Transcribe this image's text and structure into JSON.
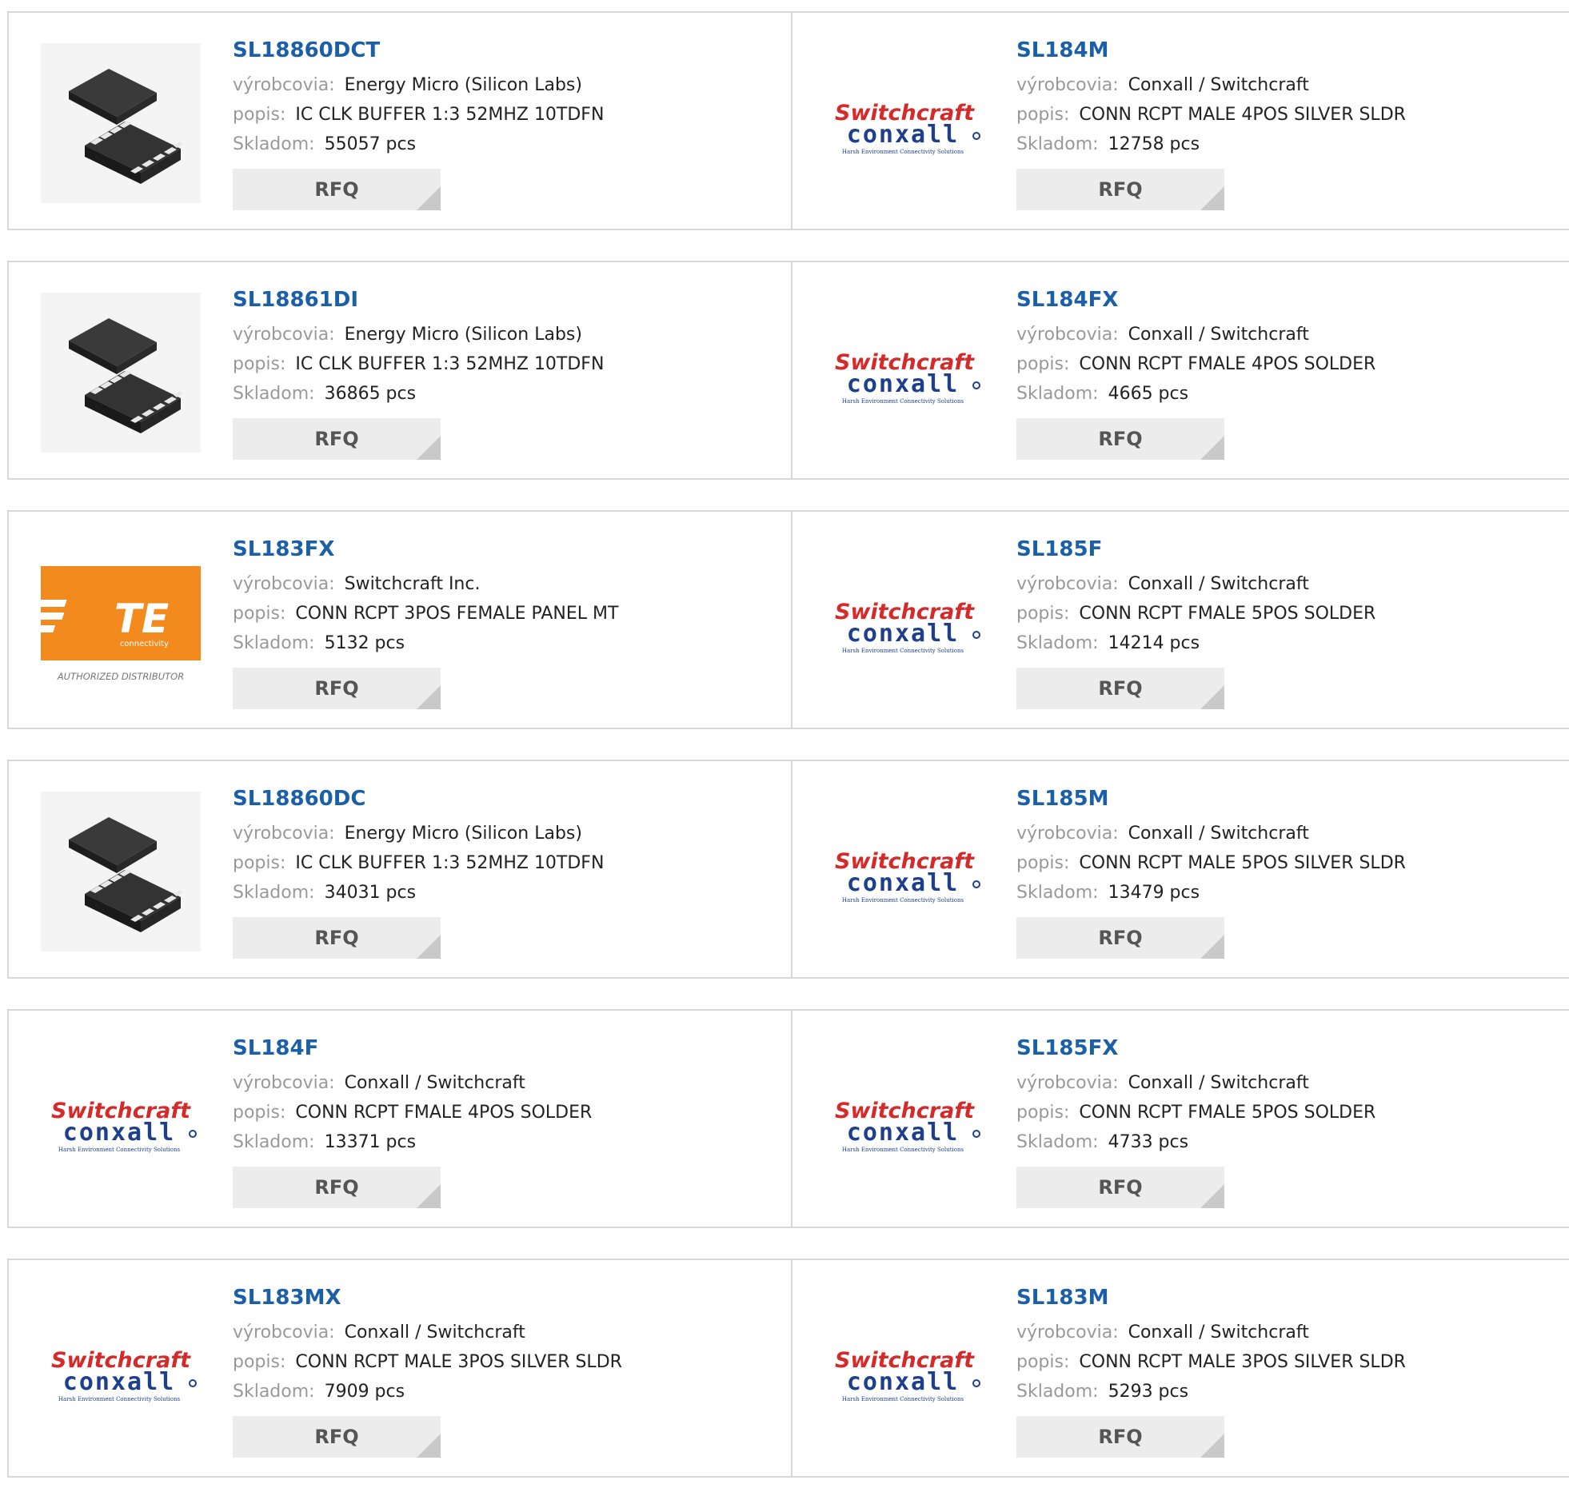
{
  "labels": {
    "manufacturer": "výrobcovia:",
    "description": "popis:",
    "stock": "Skladom:",
    "rfq": "RFQ"
  },
  "logos": {
    "switchcraft": {
      "top": "Switchcraft",
      "bottom": "conxall",
      "tagline": "Harsh Environment Connectivity Solutions",
      "red": "#d42a2a",
      "blue": "#1d3f8c"
    },
    "te": {
      "mark": "TE",
      "sub": "connectivity",
      "caption": "AUTHORIZED DISTRIBUTOR",
      "orange": "#f28a1e"
    }
  },
  "rows": [
    [
      {
        "part": "SL18860DCT",
        "manufacturer": "Energy Micro (Silicon Labs)",
        "description": "IC CLK BUFFER 1:3 52MHZ 10TDFN",
        "stock": "55057 pcs",
        "image": "ic-chip"
      },
      {
        "part": "SL184M",
        "manufacturer": "Conxall / Switchcraft",
        "description": "CONN RCPT MALE 4POS SILVER SLDR",
        "stock": "12758 pcs",
        "image": "switchcraft-logo"
      }
    ],
    [
      {
        "part": "SL18861DI",
        "manufacturer": "Energy Micro (Silicon Labs)",
        "description": "IC CLK BUFFER 1:3 52MHZ 10TDFN",
        "stock": "36865 pcs",
        "image": "ic-chip"
      },
      {
        "part": "SL184FX",
        "manufacturer": "Conxall / Switchcraft",
        "description": "CONN RCPT FMALE 4POS SOLDER",
        "stock": "4665 pcs",
        "image": "switchcraft-logo"
      }
    ],
    [
      {
        "part": "SL183FX",
        "manufacturer": "Switchcraft Inc.",
        "description": "CONN RCPT 3POS FEMALE PANEL MT",
        "stock": "5132 pcs",
        "image": "te-logo"
      },
      {
        "part": "SL185F",
        "manufacturer": "Conxall / Switchcraft",
        "description": "CONN RCPT FMALE 5POS SOLDER",
        "stock": "14214 pcs",
        "image": "switchcraft-logo"
      }
    ],
    [
      {
        "part": "SL18860DC",
        "manufacturer": "Energy Micro (Silicon Labs)",
        "description": "IC CLK BUFFER 1:3 52MHZ 10TDFN",
        "stock": "34031 pcs",
        "image": "ic-chip"
      },
      {
        "part": "SL185M",
        "manufacturer": "Conxall / Switchcraft",
        "description": "CONN RCPT MALE 5POS SILVER SLDR",
        "stock": "13479 pcs",
        "image": "switchcraft-logo"
      }
    ],
    [
      {
        "part": "SL184F",
        "manufacturer": "Conxall / Switchcraft",
        "description": "CONN RCPT FMALE 4POS SOLDER",
        "stock": "13371 pcs",
        "image": "switchcraft-logo"
      },
      {
        "part": "SL185FX",
        "manufacturer": "Conxall / Switchcraft",
        "description": "CONN RCPT FMALE 5POS SOLDER",
        "stock": "4733 pcs",
        "image": "switchcraft-logo"
      }
    ],
    [
      {
        "part": "SL183MX",
        "manufacturer": "Conxall / Switchcraft",
        "description": "CONN RCPT MALE 3POS SILVER SLDR",
        "stock": "7909 pcs",
        "image": "switchcraft-logo"
      },
      {
        "part": "SL183M",
        "manufacturer": "Conxall / Switchcraft",
        "description": "CONN RCPT MALE 3POS SILVER SLDR",
        "stock": "5293 pcs",
        "image": "switchcraft-logo"
      }
    ]
  ]
}
